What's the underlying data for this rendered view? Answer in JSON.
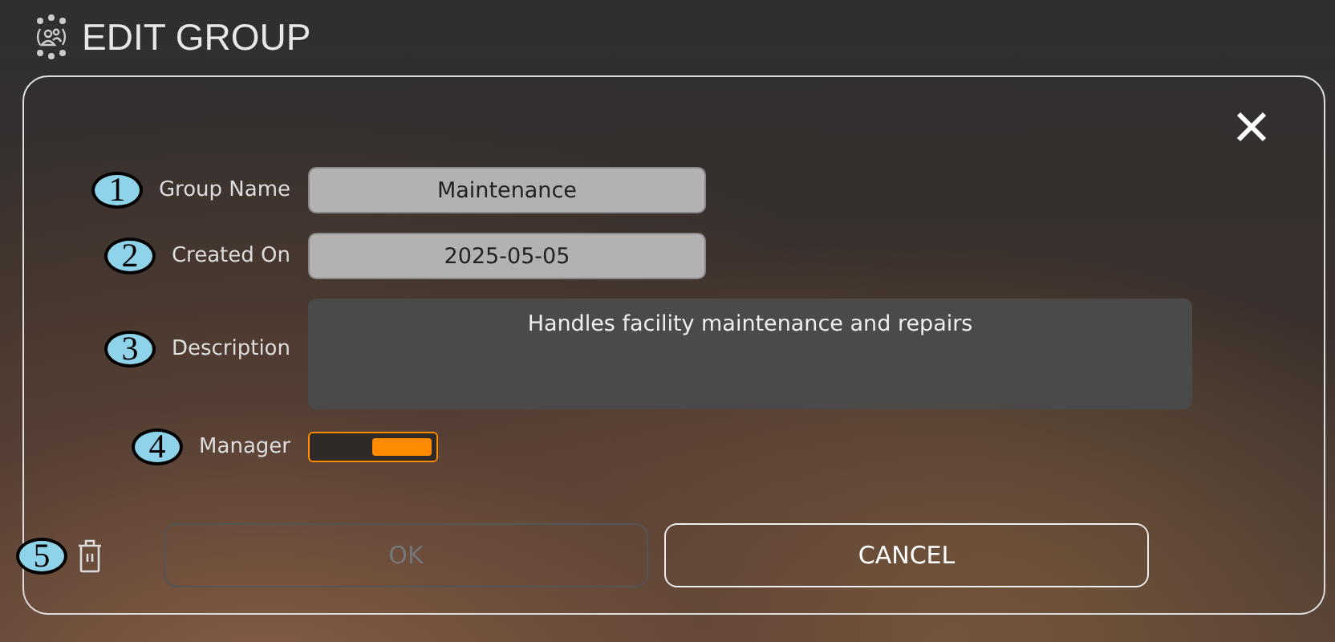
{
  "title": "EDIT GROUP",
  "fields": [
    {
      "badge": "1",
      "label": "Group Name",
      "value": "Maintenance",
      "kind": "text"
    },
    {
      "badge": "2",
      "label": "Created On",
      "value": "2025-05-05",
      "kind": "text"
    },
    {
      "badge": "3",
      "label": "Description",
      "value": "Handles facility maintenance and repairs",
      "kind": "textarea"
    },
    {
      "badge": "4",
      "label": "Manager",
      "on": true,
      "kind": "toggle"
    }
  ],
  "footer": {
    "badge": "5",
    "ok": {
      "label": "OK",
      "disabled": true
    },
    "cancel": {
      "label": "CANCEL"
    }
  }
}
